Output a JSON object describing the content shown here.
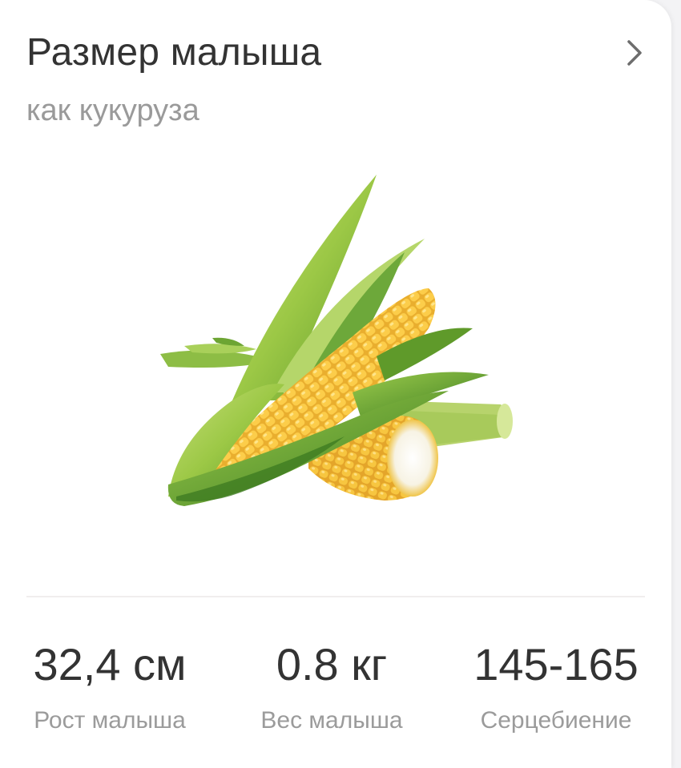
{
  "header": {
    "title": "Размер малыша",
    "subtitle": "как кукуруза"
  },
  "illustration": {
    "subject": "corn-illustration"
  },
  "stats": [
    {
      "value": "32,4 см",
      "label": "Рост малыша"
    },
    {
      "value": "0.8 кг",
      "label": "Вес малыша"
    },
    {
      "value": "145-165",
      "label": "Серцебиение"
    }
  ],
  "colors": {
    "title": "#333333",
    "subtitle": "#9a9a9a",
    "corn_kernel": "#f2c23d",
    "husk_green": "#8bbd3a"
  }
}
